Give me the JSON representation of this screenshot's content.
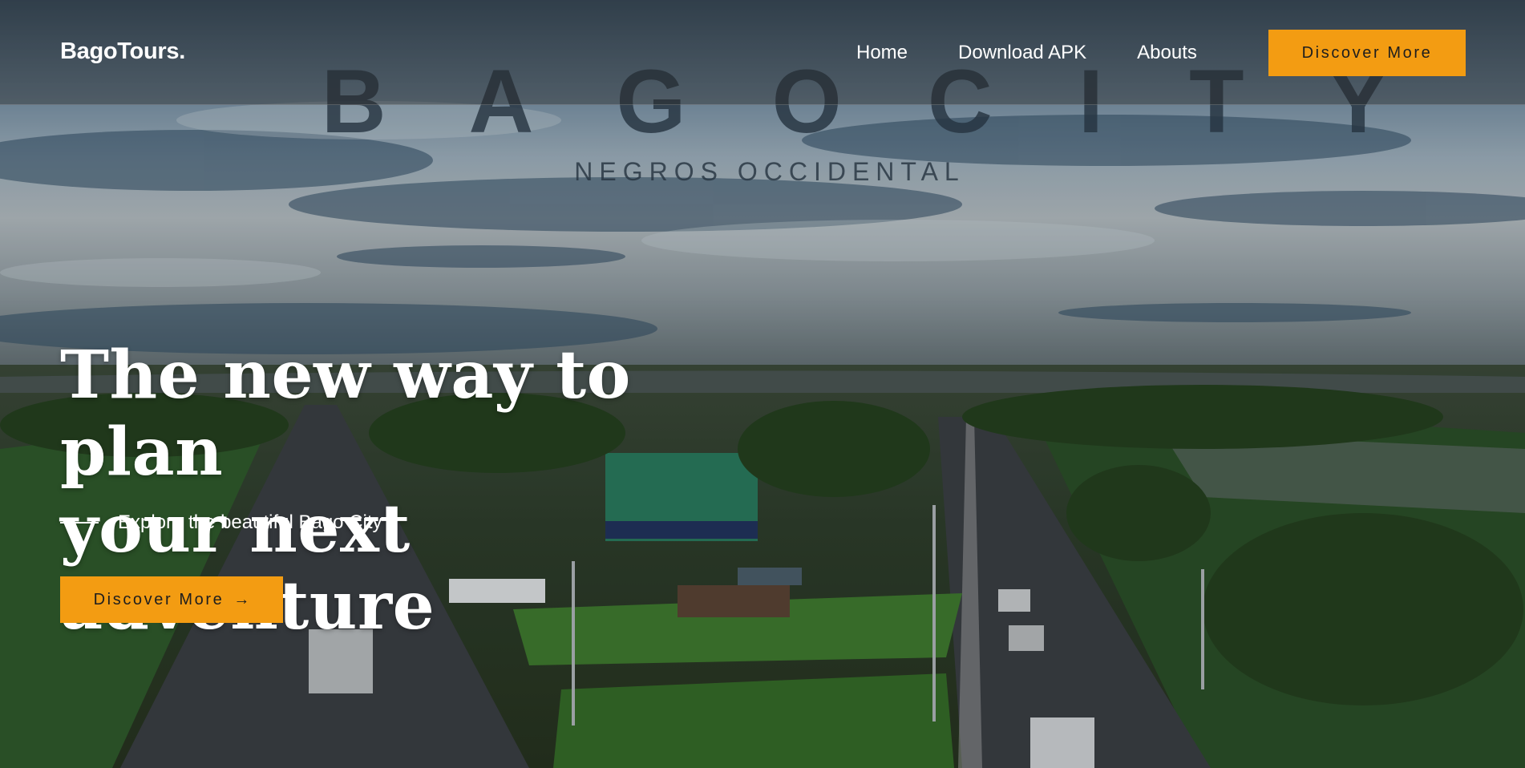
{
  "navbar": {
    "brand": "BagoTours.",
    "links": [
      "Home",
      "Download APK",
      "Abouts"
    ],
    "cta_label": "Discover More"
  },
  "hero": {
    "background_sign_title": "B A G O   C I T Y",
    "background_sign_subtitle": "NEGROS OCCIDENTAL",
    "title_line1": "The new way to plan",
    "title_line2": "your next adventure",
    "subtitle": "Explore the beautiful Bago City",
    "cta_label": "Discover More",
    "cta_icon": "arrow-right-icon"
  },
  "colors": {
    "accent": "#f39c12",
    "text_light": "#ffffff",
    "navbar_overlay": "rgba(40,40,40,0.42)"
  }
}
